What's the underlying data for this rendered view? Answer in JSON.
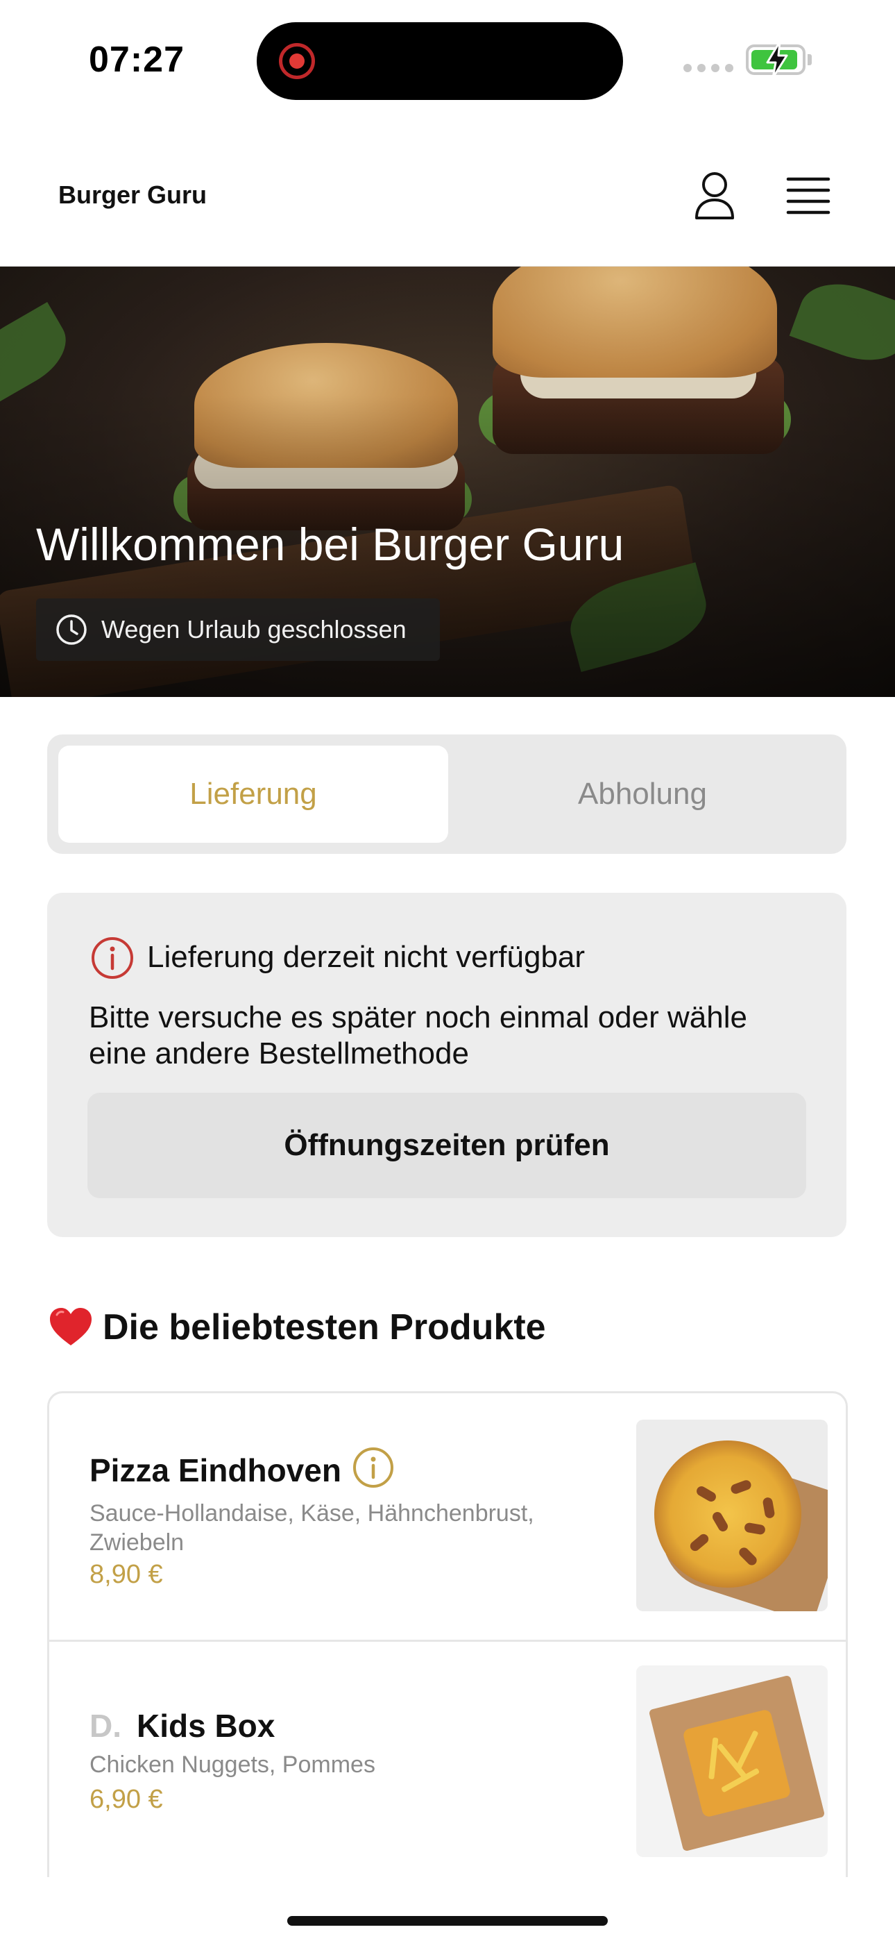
{
  "status_bar": {
    "time": "07:27"
  },
  "header": {
    "brand": "Burger Guru"
  },
  "hero": {
    "title": "Willkommen bei Burger Guru",
    "badge": "Wegen Urlaub geschlossen"
  },
  "order_mode": {
    "tabs": [
      {
        "label": "Lieferung",
        "selected": true
      },
      {
        "label": "Abholung",
        "selected": false
      }
    ]
  },
  "notice": {
    "title": "Lieferung derzeit nicht verfügbar",
    "body": "Bitte versuche es später noch einmal oder wähle eine andere Bestellmethode",
    "button": "Öffnungszeiten prüfen"
  },
  "popular": {
    "title": "Die beliebtesten Produkte",
    "products": [
      {
        "prefix": "",
        "name": "Pizza Eindhoven",
        "description": "Sauce-Hollandaise, Käse, Hähnchenbrust, Zwiebeln",
        "price": "8,90 €"
      },
      {
        "prefix": "D.",
        "name": "Kids Box",
        "description": "Chicken Nuggets, Pommes",
        "price": "6,90 €"
      }
    ]
  },
  "colors": {
    "accent": "#c2a047",
    "alert": "#c63a35",
    "battery": "#3fc43f"
  }
}
